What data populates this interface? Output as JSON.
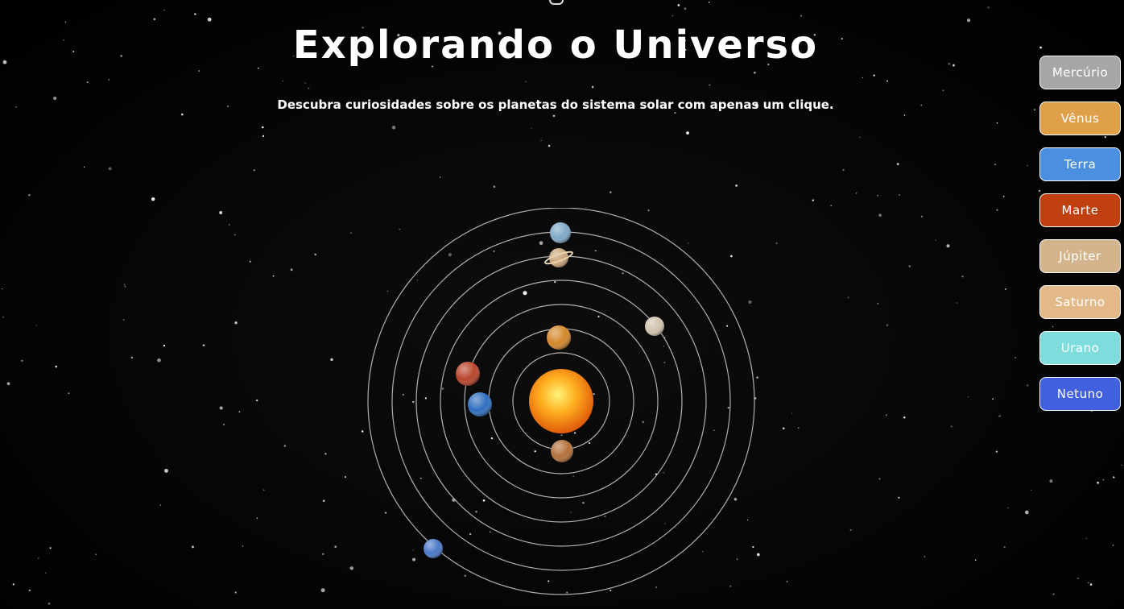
{
  "page": {
    "title": "Explorando o Universo",
    "subtitle": "Descubra curiosidades sobre os planetas do sistema solar com apenas um clique."
  },
  "planet_buttons": [
    {
      "label": "Mercúrio",
      "color": "#a6a6a6"
    },
    {
      "label": "Vênus",
      "color": "#e0a04a"
    },
    {
      "label": "Terra",
      "color": "#4a8fe0"
    },
    {
      "label": "Marte",
      "color": "#c0410f"
    },
    {
      "label": "Júpiter",
      "color": "#d4b48c"
    },
    {
      "label": "Saturno",
      "color": "#e3b98a"
    },
    {
      "label": "Urano",
      "color": "#7fdcdc"
    },
    {
      "label": "Netuno",
      "color": "#4060e0"
    }
  ],
  "solar_system": {
    "sun_color": "#ff9a1a",
    "orbit_color": "#cccccc",
    "planets": [
      {
        "name": "mercury",
        "color": "#b2703a"
      },
      {
        "name": "venus",
        "color": "#d4872a"
      },
      {
        "name": "earth",
        "color": "#2f6fbf"
      },
      {
        "name": "mars",
        "color": "#b8442a"
      },
      {
        "name": "jupiter",
        "color": "#cfc2ae"
      },
      {
        "name": "saturn",
        "color": "#c9a37a"
      },
      {
        "name": "uranus",
        "color": "#7fa8c8"
      },
      {
        "name": "neptune",
        "color": "#4a78c8"
      }
    ]
  }
}
